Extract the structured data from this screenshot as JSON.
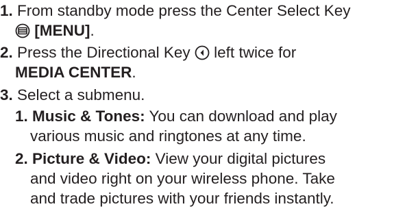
{
  "steps": [
    {
      "number": "1.",
      "text_before": "From standby mode press the Center Select Key",
      "icon": "center-select-key-icon",
      "key_label": "[MENU]",
      "text_after": "."
    },
    {
      "number": "2.",
      "text_before": "Press the Directional Key",
      "icon": "directional-key-left-icon",
      "text_middle": "left twice for",
      "target": "MEDIA CENTER",
      "text_after": "."
    },
    {
      "number": "3.",
      "text": "Select a submenu.",
      "submenu": [
        {
          "title": "1. Music & Tones:",
          "desc_line1": "You can download and play",
          "desc_line2": "various music and ringtones at any time."
        },
        {
          "title": "2. Picture & Video:",
          "desc_line1": "View your digital pictures",
          "desc_line2": "and video right on your wireless phone. Take",
          "desc_line3": "and trade pictures with your friends instantly."
        }
      ]
    }
  ]
}
